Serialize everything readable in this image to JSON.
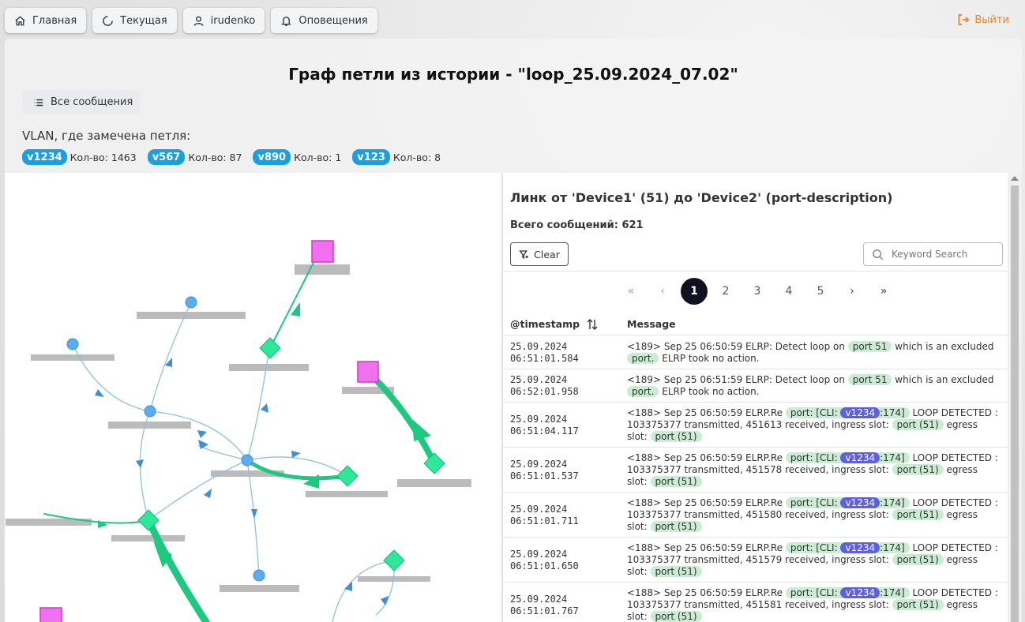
{
  "nav": {
    "home": "Главная",
    "current": "Текущая",
    "user": "irudenko",
    "alerts": "Оповещения",
    "logout": "Выйти"
  },
  "page": {
    "title": "Граф петли из истории - \"loop_25.09.2024_07.02\"",
    "all_messages": "Все сообщения",
    "vlan_label": "VLAN, где замечена петля:"
  },
  "vlans": [
    {
      "tag": "v1234",
      "count": "Кол-во: 1463"
    },
    {
      "tag": "v567",
      "count": "Кол-во: 87"
    },
    {
      "tag": "v890",
      "count": "Кол-во: 1"
    },
    {
      "tag": "v123",
      "count": "Кол-во: 8"
    }
  ],
  "colors": {
    "vlan_tag": "#1a9fe0",
    "logout": "#e8842a",
    "edge_strong": "#1cc97e",
    "edge_weak": "#8fbfe0",
    "node_circle": "#5aaef0",
    "node_diamond": "#2ee89a",
    "node_square": "#f070f0"
  },
  "detail": {
    "title": "Линк от 'Device1' (51) до 'Device2' (port-description)",
    "count": "Всего сообщений: 621",
    "clear": "Clear",
    "search_placeholder": "Keyword Search",
    "pages": [
      "1",
      "2",
      "3",
      "4",
      "5"
    ],
    "active_page": "1",
    "col_timestamp": "@timestamp",
    "col_message": "Message"
  },
  "rows": [
    {
      "date": "25.09.2024",
      "time": "06:51:01.584",
      "type": "elrp",
      "pre": "<189> Sep 25 06:50:59 ELRP: Detect loop on ",
      "port": "port 51",
      "mid": " which is an excluded ",
      "chip2": "port.",
      "post": " ELRP took no action."
    },
    {
      "date": "25.09.2024",
      "time": "06:52:01.958",
      "type": "elrp",
      "pre": "<189> Sep 25 06:51:59 ELRP: Detect loop on ",
      "port": "port 51",
      "mid": " which is an excluded ",
      "chip2": "port.",
      "post": " ELRP took no action."
    },
    {
      "date": "25.09.2024",
      "time": "06:51:04.117",
      "type": "loop",
      "pre": "<188> Sep 25 06:50:59 ELRP.Re ",
      "cli": "port: [CLI: ",
      "vlan": "v1234",
      "cli_end": ":174]",
      "mid": " LOOP DETECTED : 103375377 transmitted, 451613 received, ingress slot: ",
      "ing": "port (51)",
      "egr_label": " egress slot: ",
      "egr": "port (51)"
    },
    {
      "date": "25.09.2024",
      "time": "06:51:01.537",
      "type": "loop",
      "pre": "<188> Sep 25 06:50:59 ELRP.Re ",
      "cli": "port: [CLI: ",
      "vlan": "v1234",
      "cli_end": ":174]",
      "mid": " LOOP DETECTED : 103375377 transmitted, 451578 received, ingress slot: ",
      "ing": "port (51)",
      "egr_label": " egress slot: ",
      "egr": "port (51)"
    },
    {
      "date": "25.09.2024",
      "time": "06:51:01.711",
      "type": "loop",
      "pre": "<188> Sep 25 06:50:59 ELRP.Re ",
      "cli": "port: [CLI: ",
      "vlan": "v1234",
      "cli_end": ":174]",
      "mid": " LOOP DETECTED : 103375377 transmitted, 451580 received, ingress slot: ",
      "ing": "port (51)",
      "egr_label": " egress slot: ",
      "egr": "port (51)"
    },
    {
      "date": "25.09.2024",
      "time": "06:51:01.650",
      "type": "loop",
      "pre": "<188> Sep 25 06:50:59 ELRP.Re ",
      "cli": "port: [CLI: ",
      "vlan": "v1234",
      "cli_end": ":174]",
      "mid": " LOOP DETECTED : 103375377 transmitted, 451579 received, ingress slot: ",
      "ing": "port (51)",
      "egr_label": " egress slot: ",
      "egr": "port (51)"
    },
    {
      "date": "25.09.2024",
      "time": "06:51:01.767",
      "type": "loop",
      "pre": "<188> Sep 25 06:50:59 ELRP.Re ",
      "cli": "port: [CLI: ",
      "vlan": "v1234",
      "cli_end": ":174]",
      "mid": " LOOP DETECTED : 103375377 transmitted, 451581 received, ingress slot: ",
      "ing": "port (51)",
      "egr_label": " egress slot: ",
      "egr": "port (51)"
    }
  ]
}
